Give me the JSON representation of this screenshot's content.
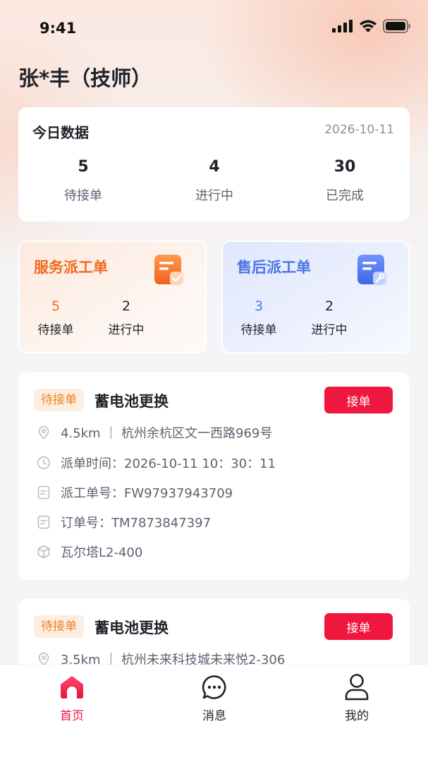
{
  "status_bar": {
    "time": "9:41"
  },
  "header": {
    "title": "张*丰（技师）"
  },
  "today": {
    "title": "今日数据",
    "date": "2026-10-11",
    "stats": [
      {
        "value": "5",
        "label": "待接单"
      },
      {
        "value": "4",
        "label": "进行中"
      },
      {
        "value": "30",
        "label": "已完成"
      }
    ]
  },
  "dispatch": {
    "service": {
      "title": "服务派工单",
      "stats": [
        {
          "value": "5",
          "label": "待接单"
        },
        {
          "value": "2",
          "label": "进行中"
        }
      ]
    },
    "after_sales": {
      "title": "售后派工单",
      "stats": [
        {
          "value": "3",
          "label": "待接单"
        },
        {
          "value": "2",
          "label": "进行中"
        }
      ]
    }
  },
  "orders": [
    {
      "tag": "待接单",
      "title": "蓄电池更换",
      "action": "接单",
      "location": "4.5km ｜ 杭州余杭区文一西路969号",
      "dispatch_time": "派单时间：2026-10-11 10：30：11",
      "work_order_no": "派工单号：FW97937943709",
      "order_no": "订单号：TM7873847397",
      "product": "瓦尔塔L2-400"
    },
    {
      "tag": "待接单",
      "title": "蓄电池更换",
      "action": "接单",
      "location": "3.5km ｜ 杭州未来科技城未来悦2-306"
    }
  ],
  "tabbar": {
    "items": [
      {
        "label": "首页",
        "icon": "home-icon"
      },
      {
        "label": "消息",
        "icon": "message-icon"
      },
      {
        "label": "我的",
        "icon": "user-icon"
      }
    ]
  },
  "colors": {
    "accent": "#f0173f",
    "service_orange": "#f06a1d",
    "after_blue": "#4b74e6",
    "tag_bg": "#fdeee3",
    "tag_text": "#f0801e"
  }
}
